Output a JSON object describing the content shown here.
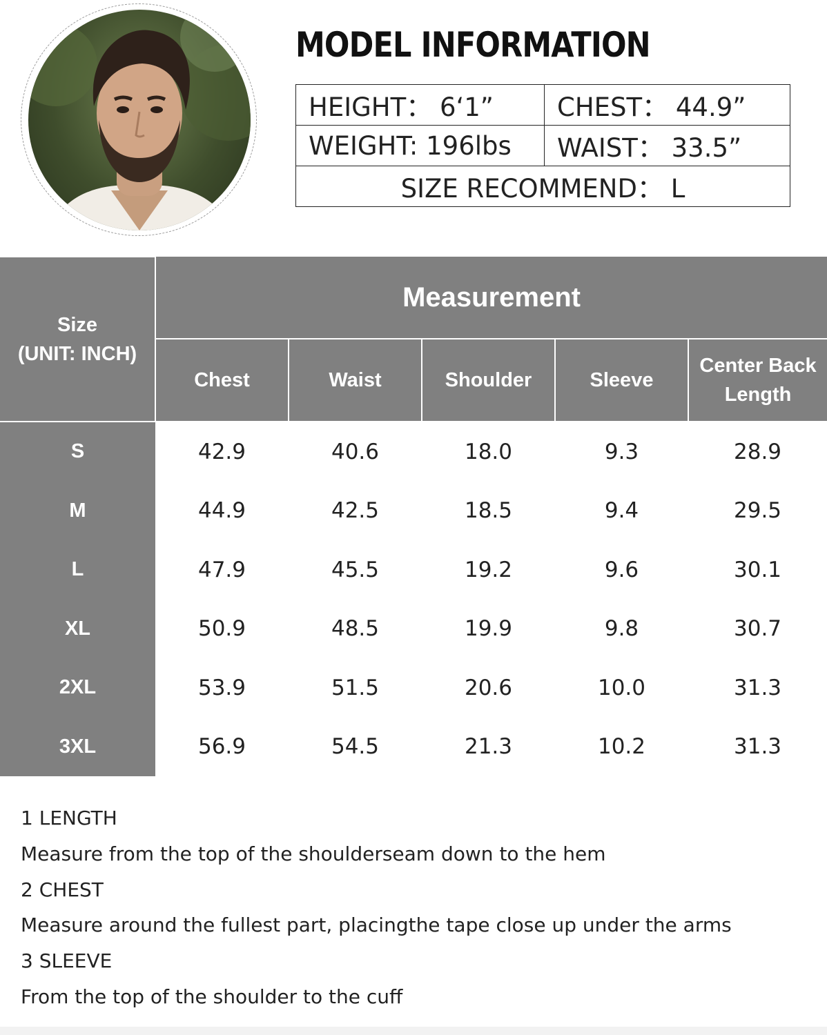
{
  "model_info": {
    "title": "MODEL INFORMATION",
    "height": "HEIGHT：  6‘1”",
    "chest": "CHEST：  44.9”",
    "weight": "WEIGHT: 196lbs",
    "waist": "WAIST：  33.5”",
    "size_recommend": "SIZE RECOMMEND：  L"
  },
  "size_table": {
    "size_header_line1": "Size",
    "size_header_line2": "(UNIT: INCH)",
    "group_header": "Measurement",
    "columns": [
      "Chest",
      "Waist",
      "Shoulder",
      "Sleeve",
      "Center Back Length"
    ],
    "rows": [
      {
        "size": "S",
        "values": [
          "42.9",
          "40.6",
          "18.0",
          "9.3",
          "28.9"
        ]
      },
      {
        "size": "M",
        "values": [
          "44.9",
          "42.5",
          "18.5",
          "9.4",
          "29.5"
        ]
      },
      {
        "size": "L",
        "values": [
          "47.9",
          "45.5",
          "19.2",
          "9.6",
          "30.1"
        ]
      },
      {
        "size": "XL",
        "values": [
          "50.9",
          "48.5",
          "19.9",
          "9.8",
          "30.7"
        ]
      },
      {
        "size": "2XL",
        "values": [
          "53.9",
          "51.5",
          "20.6",
          "10.0",
          "31.3"
        ]
      },
      {
        "size": "3XL",
        "values": [
          "56.9",
          "54.5",
          "21.3",
          "10.2",
          "31.3"
        ]
      }
    ]
  },
  "notes": [
    "1 LENGTH",
    "Measure from the top of the shoulderseam down to the hem",
    "2 CHEST",
    "Measure around the fullest part, placingthe tape close up under the arms",
    "3 SLEEVE",
    "From the top of the shoulder to the cuff"
  ],
  "colors": {
    "header_gray": "#808080",
    "text": "#222222"
  }
}
